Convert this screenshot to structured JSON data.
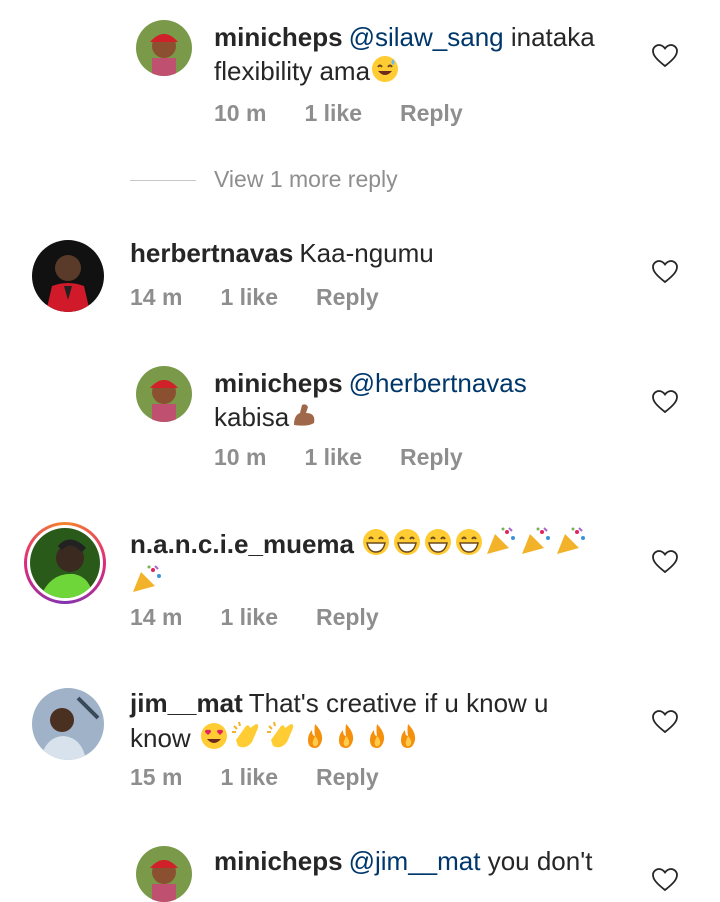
{
  "comments": [
    {
      "username": "minicheps",
      "mention": "@silaw_sang",
      "text": "inataka flexibility ama",
      "emojis": [
        "grinning-sweat"
      ],
      "time": "10 m",
      "likes": "1 like",
      "reply_label": "Reply"
    },
    {
      "username": "herbertnavas",
      "mention": "",
      "text": "Kaa-ngumu",
      "emojis": [],
      "time": "14 m",
      "likes": "1 like",
      "reply_label": "Reply"
    },
    {
      "username": "minicheps",
      "mention": "@herbertnavas",
      "text": "kabisa",
      "emojis": [
        "flexed-biceps"
      ],
      "time": "10 m",
      "likes": "1 like",
      "reply_label": "Reply"
    },
    {
      "username": "n.a.n.c.i.e_muema",
      "mention": "",
      "text": "",
      "emojis": [
        "grinning",
        "grinning",
        "grinning",
        "grinning",
        "party-popper",
        "party-popper",
        "party-popper",
        "party-popper"
      ],
      "time": "14 m",
      "likes": "1 like",
      "reply_label": "Reply"
    },
    {
      "username": "jim__mat",
      "mention": "",
      "text": "That's creative if u know u know",
      "emojis": [
        "heart-eyes",
        "clapping",
        "clapping",
        "fire",
        "fire",
        "fire",
        "fire"
      ],
      "time": "15 m",
      "likes": "1 like",
      "reply_label": "Reply"
    },
    {
      "username": "minicheps",
      "mention": "@jim__mat",
      "text": "you don't",
      "emojis": [],
      "time": "",
      "likes": "",
      "reply_label": ""
    }
  ],
  "view_more_replies": "View 1 more reply",
  "icons": {
    "like": "heart-outline-icon"
  },
  "colors": {
    "mention": "#00376b",
    "meta": "#8e8e8e",
    "text": "#262626"
  }
}
